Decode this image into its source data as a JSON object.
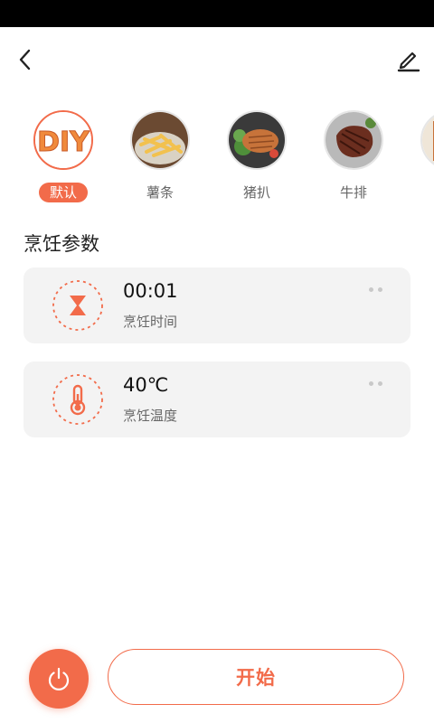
{
  "colors": {
    "accent": "#f26b4a",
    "card_bg": "#f3f3f3"
  },
  "header": {
    "back_icon": "chevron-left-icon",
    "edit_icon": "pencil-icon"
  },
  "recipes": [
    {
      "label": "默认",
      "selected": true,
      "thumb_text": "DIY"
    },
    {
      "label": "薯条",
      "selected": false
    },
    {
      "label": "猪扒",
      "selected": false
    },
    {
      "label": "牛排",
      "selected": false
    },
    {
      "label": "",
      "selected": false
    }
  ],
  "section": {
    "title": "烹饪参数"
  },
  "params": {
    "time": {
      "value": "00:01",
      "label": "烹饪时间",
      "icon": "hourglass-icon"
    },
    "temp": {
      "value": "40℃",
      "label": "烹饪温度",
      "icon": "thermometer-icon"
    }
  },
  "bottom": {
    "power_icon": "power-icon",
    "start_label": "开始"
  }
}
